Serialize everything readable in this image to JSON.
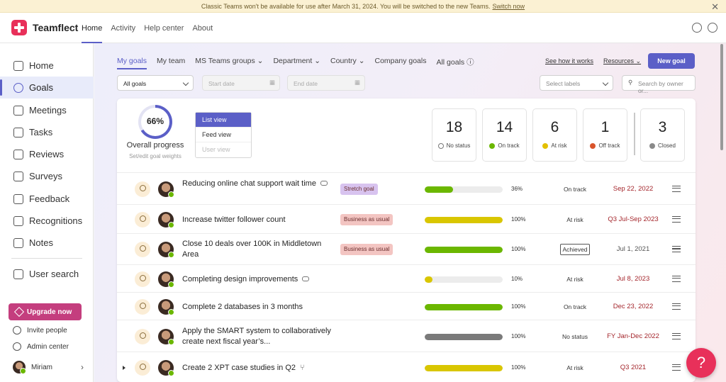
{
  "banner": {
    "text": "Classic Teams won't be available for use after March 31, 2024. You will be switched to the new Teams.",
    "link": "Switch now"
  },
  "app": {
    "name": "Teamflect"
  },
  "topnav": [
    "Home",
    "Activity",
    "Help center",
    "About"
  ],
  "sidebar": {
    "items": [
      "Home",
      "Goals",
      "Meetings",
      "Tasks",
      "Reviews",
      "Surveys",
      "Feedback",
      "Recognitions",
      "Notes"
    ],
    "user_search": "User search",
    "upgrade": "Upgrade now",
    "invite": "Invite people",
    "admin": "Admin center",
    "user": "Miriam"
  },
  "goal_tabs": [
    "My goals",
    "My team",
    "MS Teams groups",
    "Department",
    "Country",
    "Company goals",
    "All goals"
  ],
  "links": {
    "how": "See how it works",
    "resources": "Resources"
  },
  "new_goal": "New goal",
  "filters": {
    "goals_value": "All goals",
    "start_placeholder": "Start date",
    "end_placeholder": "End date",
    "labels_placeholder": "Select labels",
    "search_placeholder": "Search by owner or..."
  },
  "progress": {
    "value": "66%",
    "fraction": 0.66,
    "label": "Overall progress",
    "weights_link": "Set/edit goal weights"
  },
  "views": [
    "List view",
    "Feed view",
    "User view"
  ],
  "stats": [
    {
      "n": "18",
      "label": "No status",
      "color": "#ffffff"
    },
    {
      "n": "14",
      "label": "On track",
      "color": "#6bb700"
    },
    {
      "n": "6",
      "label": "At risk",
      "color": "#e3c000"
    },
    {
      "n": "1",
      "label": "Off track",
      "color": "#d9542b"
    },
    {
      "n": "3",
      "label": "Closed",
      "color": "#8a8a8a"
    }
  ],
  "goals": [
    {
      "title": "Reducing online chat support wait time",
      "tag": "Stretch goal",
      "tag_color": "#d8c3ef",
      "progress": 0.36,
      "pct": "36%",
      "bar_color": "#6bb700",
      "status": "On track",
      "date": "Sep 22, 2022"
    },
    {
      "title": "Increase twitter follower count",
      "tag": "Business as usual",
      "tag_color": "#f3c5c2",
      "progress": 1.0,
      "pct": "100%",
      "bar_color": "#d9c600",
      "status": "At risk",
      "date": "Q3 Jul-Sep 2023"
    },
    {
      "title": "Close 10 deals over 100K in Middletown Area",
      "tag": "Business as usual",
      "tag_color": "#f3c5c2",
      "progress": 1.0,
      "pct": "100%",
      "bar_color": "#6bb700",
      "status": "Achieved",
      "date": "Jul 1, 2021"
    },
    {
      "title": "Completing design improvements",
      "tag": "",
      "tag_color": "",
      "progress": 0.1,
      "pct": "10%",
      "bar_color": "#d9c600",
      "status": "At risk",
      "date": "Jul 8, 2023"
    },
    {
      "title": "Complete 2 databases in 3 months",
      "tag": "",
      "tag_color": "",
      "progress": 1.0,
      "pct": "100%",
      "bar_color": "#6bb700",
      "status": "On track",
      "date": "Dec 23, 2022"
    },
    {
      "title": "Apply the SMART system to collaboratively create next fiscal year’s...",
      "tag": "",
      "tag_color": "",
      "progress": 1.0,
      "pct": "100%",
      "bar_color": "#7a7a7a",
      "status": "No status",
      "date": "FY Jan-Dec 2022"
    },
    {
      "title": "Create 2 XPT case studies in Q2",
      "tag": "",
      "tag_color": "",
      "progress": 1.0,
      "pct": "100%",
      "bar_color": "#d9c600",
      "status": "At risk",
      "date": "Q3 2021"
    }
  ],
  "help": "?"
}
